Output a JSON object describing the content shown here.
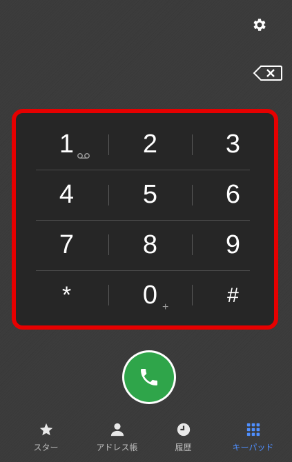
{
  "toolbar": {
    "settings_icon": "gear-icon",
    "backspace_icon": "backspace-icon"
  },
  "keypad": {
    "keys": [
      {
        "digit": "1",
        "sub": "voicemail"
      },
      {
        "digit": "2",
        "sub": ""
      },
      {
        "digit": "3",
        "sub": ""
      },
      {
        "digit": "4",
        "sub": ""
      },
      {
        "digit": "5",
        "sub": ""
      },
      {
        "digit": "6",
        "sub": ""
      },
      {
        "digit": "7",
        "sub": ""
      },
      {
        "digit": "8",
        "sub": ""
      },
      {
        "digit": "9",
        "sub": ""
      },
      {
        "digit": "*",
        "sub": ""
      },
      {
        "digit": "0",
        "sub": "+"
      },
      {
        "digit": "#",
        "sub": ""
      }
    ]
  },
  "call_button": {
    "icon": "phone-icon",
    "color": "#2fa54a"
  },
  "nav": {
    "items": [
      {
        "label": "スター",
        "icon": "star-icon"
      },
      {
        "label": "アドレス帳",
        "icon": "person-icon"
      },
      {
        "label": "履歴",
        "icon": "clock-icon"
      },
      {
        "label": "キーパッド",
        "icon": "dialpad-icon",
        "active": true
      }
    ],
    "active_color": "#4f8fff"
  },
  "highlight_color": "#e60000"
}
